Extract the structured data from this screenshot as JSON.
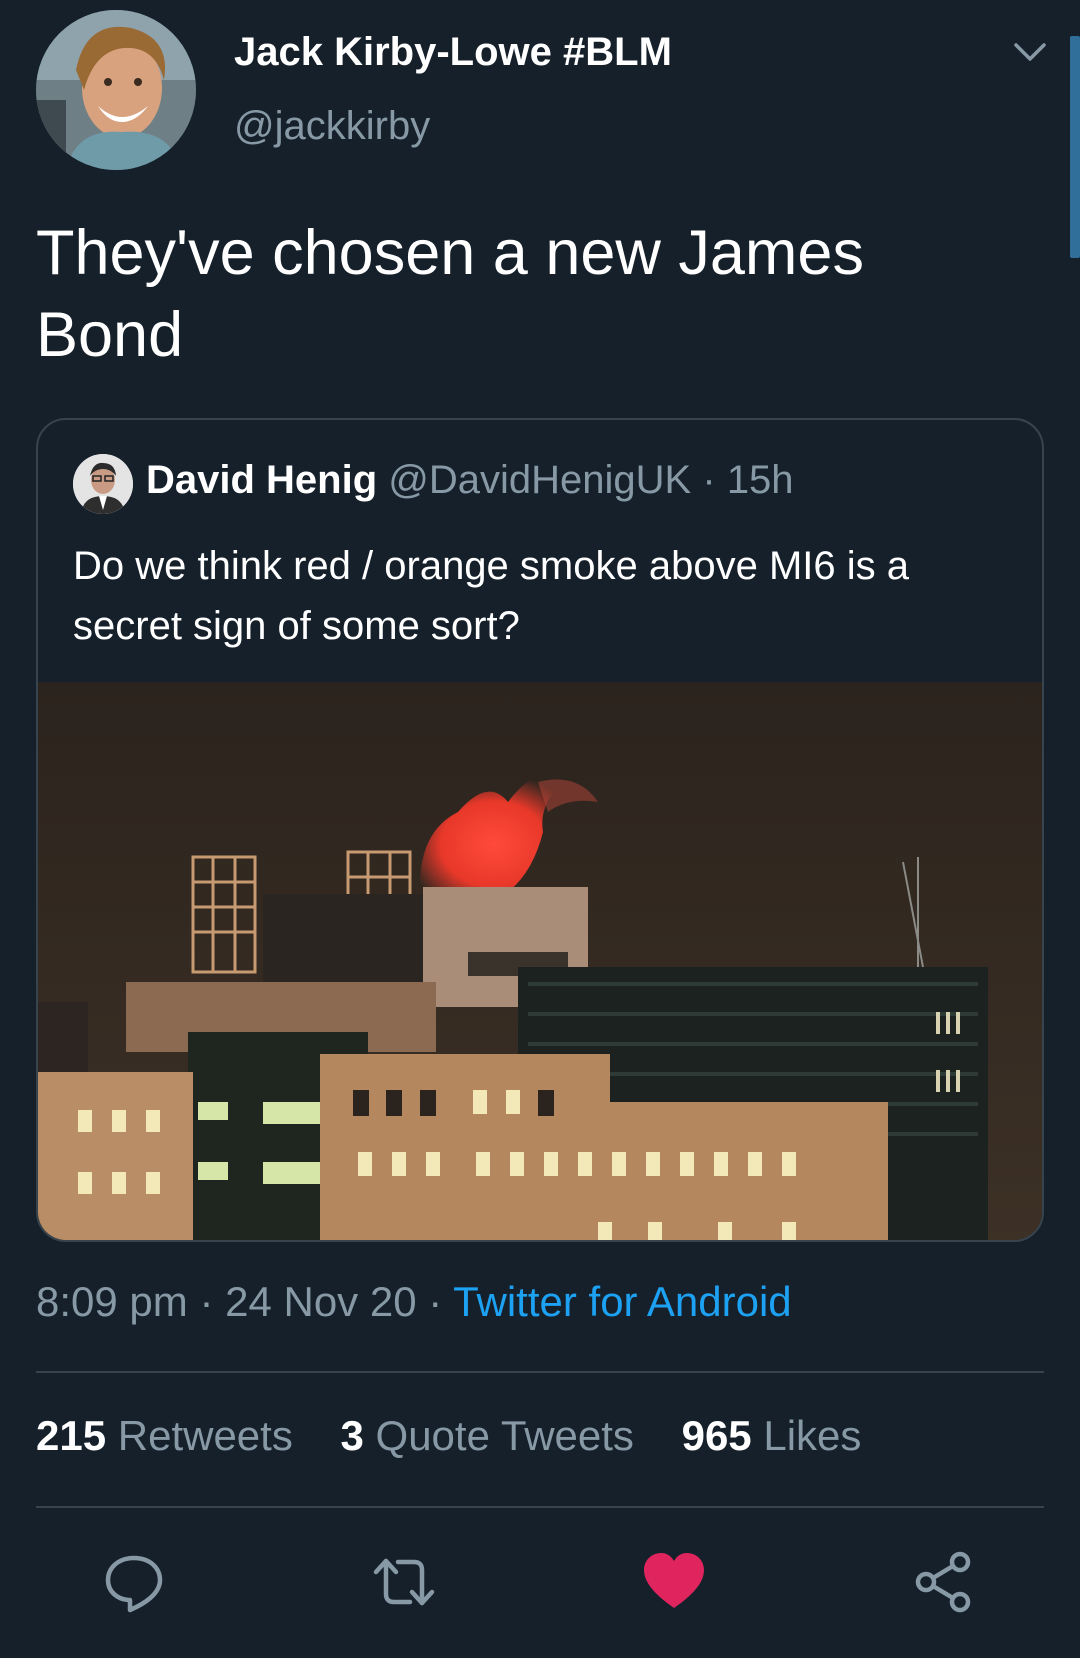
{
  "tweet": {
    "author_name": "Jack Kirby-Lowe #BLM",
    "author_handle": "@jackkirby",
    "text": "They've chosen a new James Bond"
  },
  "quote": {
    "author_name": "David Henig",
    "author_handle": "@DavidHenigUK",
    "separator": "·",
    "time": "15h",
    "text": "Do we think red / orange smoke above MI6 is a secret sign of some sort?"
  },
  "meta": {
    "time": "8:09 pm",
    "separator": "·",
    "date": "24 Nov 20",
    "source": "Twitter for Android"
  },
  "stats": {
    "retweets_count": "215",
    "retweets_label": "Retweets",
    "quotes_count": "3",
    "quotes_label": "Quote Tweets",
    "likes_count": "965",
    "likes_label": "Likes"
  },
  "actions": [
    "reply-icon",
    "retweet-icon",
    "like-icon",
    "share-icon"
  ],
  "colors": {
    "background": "#15202b",
    "text": "#ffffff",
    "secondary": "#8899a6",
    "link": "#1da1f2",
    "like": "#e0245e",
    "border": "#38444d"
  }
}
